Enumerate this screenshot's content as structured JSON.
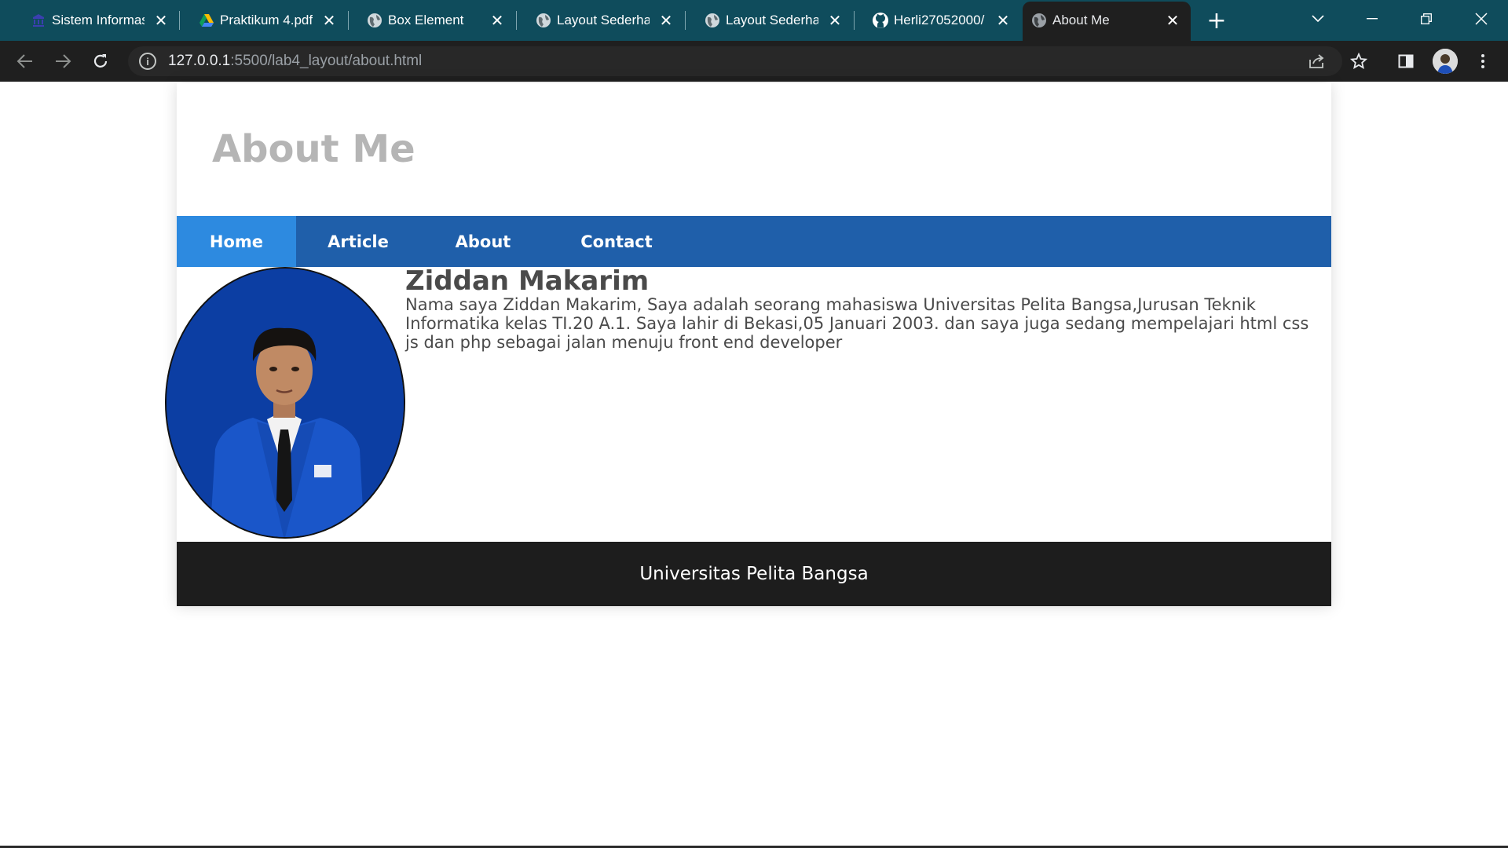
{
  "browser": {
    "tabs": [
      {
        "title": "Sistem Informasi",
        "icon": "university-icon"
      },
      {
        "title": "Praktikum 4.pdf",
        "icon": "google-drive-icon"
      },
      {
        "title": "Box Element",
        "icon": "globe-icon"
      },
      {
        "title": "Layout Sederhana",
        "icon": "globe-icon"
      },
      {
        "title": "Layout Sederhana",
        "icon": "globe-icon"
      },
      {
        "title": "Herli27052000/",
        "icon": "github-icon"
      },
      {
        "title": "About Me",
        "icon": "globe-icon",
        "active": true
      }
    ],
    "close_glyph": "✕",
    "new_tab_glyph": "+",
    "url_host": "127.0.0.1",
    "url_path": ":5500/lab4_layout/about.html",
    "info_glyph": "i",
    "colors": {
      "tabbar": "#0f4c5c",
      "toolbar": "#1f1f1f"
    }
  },
  "page": {
    "site_title": "About Me",
    "nav": [
      {
        "label": "Home",
        "active": true
      },
      {
        "label": "Article"
      },
      {
        "label": "About"
      },
      {
        "label": "Contact"
      }
    ],
    "profile": {
      "name": "Ziddan Makarim",
      "bio": "Nama saya Ziddan Makarim, Saya adalah seorang mahasiswa Universitas Pelita Bangsa,Jurusan Teknik Informatika kelas TI.20 A.1. Saya lahir di Bekasi,05 Januari 2003. dan saya juga sedang mempelajari html css js dan php sebagai jalan menuju front end developer"
    },
    "footer": "Universitas Pelita Bangsa",
    "colors": {
      "nav_bg": "#1f5faa",
      "nav_active": "#2d8ae0",
      "footer_bg": "#1d1d1d",
      "title": "#b5b5b5"
    }
  }
}
